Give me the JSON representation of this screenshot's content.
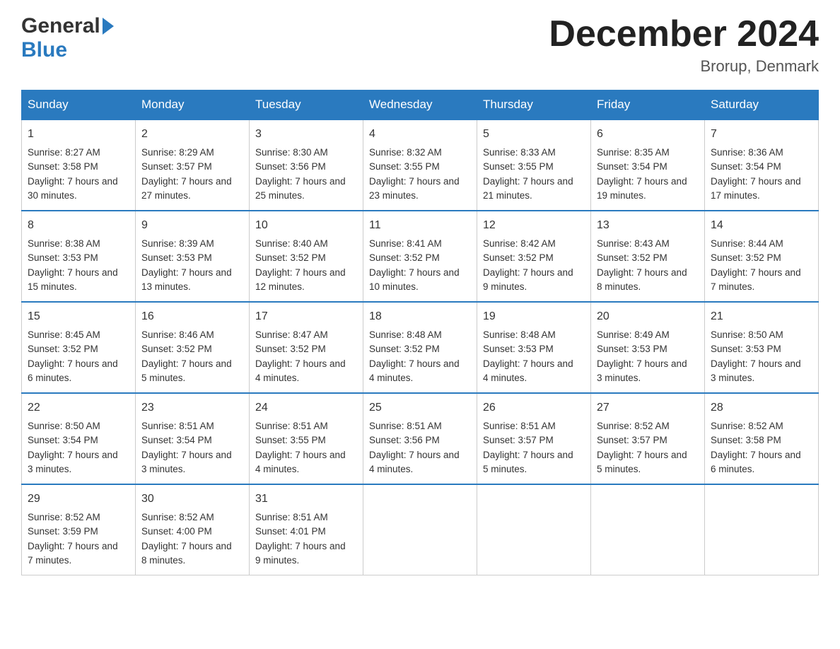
{
  "header": {
    "logo_general": "General",
    "logo_blue": "Blue",
    "month_title": "December 2024",
    "location": "Brorup, Denmark"
  },
  "days_of_week": [
    "Sunday",
    "Monday",
    "Tuesday",
    "Wednesday",
    "Thursday",
    "Friday",
    "Saturday"
  ],
  "weeks": [
    [
      {
        "day": "1",
        "sunrise": "Sunrise: 8:27 AM",
        "sunset": "Sunset: 3:58 PM",
        "daylight": "Daylight: 7 hours and 30 minutes."
      },
      {
        "day": "2",
        "sunrise": "Sunrise: 8:29 AM",
        "sunset": "Sunset: 3:57 PM",
        "daylight": "Daylight: 7 hours and 27 minutes."
      },
      {
        "day": "3",
        "sunrise": "Sunrise: 8:30 AM",
        "sunset": "Sunset: 3:56 PM",
        "daylight": "Daylight: 7 hours and 25 minutes."
      },
      {
        "day": "4",
        "sunrise": "Sunrise: 8:32 AM",
        "sunset": "Sunset: 3:55 PM",
        "daylight": "Daylight: 7 hours and 23 minutes."
      },
      {
        "day": "5",
        "sunrise": "Sunrise: 8:33 AM",
        "sunset": "Sunset: 3:55 PM",
        "daylight": "Daylight: 7 hours and 21 minutes."
      },
      {
        "day": "6",
        "sunrise": "Sunrise: 8:35 AM",
        "sunset": "Sunset: 3:54 PM",
        "daylight": "Daylight: 7 hours and 19 minutes."
      },
      {
        "day": "7",
        "sunrise": "Sunrise: 8:36 AM",
        "sunset": "Sunset: 3:54 PM",
        "daylight": "Daylight: 7 hours and 17 minutes."
      }
    ],
    [
      {
        "day": "8",
        "sunrise": "Sunrise: 8:38 AM",
        "sunset": "Sunset: 3:53 PM",
        "daylight": "Daylight: 7 hours and 15 minutes."
      },
      {
        "day": "9",
        "sunrise": "Sunrise: 8:39 AM",
        "sunset": "Sunset: 3:53 PM",
        "daylight": "Daylight: 7 hours and 13 minutes."
      },
      {
        "day": "10",
        "sunrise": "Sunrise: 8:40 AM",
        "sunset": "Sunset: 3:52 PM",
        "daylight": "Daylight: 7 hours and 12 minutes."
      },
      {
        "day": "11",
        "sunrise": "Sunrise: 8:41 AM",
        "sunset": "Sunset: 3:52 PM",
        "daylight": "Daylight: 7 hours and 10 minutes."
      },
      {
        "day": "12",
        "sunrise": "Sunrise: 8:42 AM",
        "sunset": "Sunset: 3:52 PM",
        "daylight": "Daylight: 7 hours and 9 minutes."
      },
      {
        "day": "13",
        "sunrise": "Sunrise: 8:43 AM",
        "sunset": "Sunset: 3:52 PM",
        "daylight": "Daylight: 7 hours and 8 minutes."
      },
      {
        "day": "14",
        "sunrise": "Sunrise: 8:44 AM",
        "sunset": "Sunset: 3:52 PM",
        "daylight": "Daylight: 7 hours and 7 minutes."
      }
    ],
    [
      {
        "day": "15",
        "sunrise": "Sunrise: 8:45 AM",
        "sunset": "Sunset: 3:52 PM",
        "daylight": "Daylight: 7 hours and 6 minutes."
      },
      {
        "day": "16",
        "sunrise": "Sunrise: 8:46 AM",
        "sunset": "Sunset: 3:52 PM",
        "daylight": "Daylight: 7 hours and 5 minutes."
      },
      {
        "day": "17",
        "sunrise": "Sunrise: 8:47 AM",
        "sunset": "Sunset: 3:52 PM",
        "daylight": "Daylight: 7 hours and 4 minutes."
      },
      {
        "day": "18",
        "sunrise": "Sunrise: 8:48 AM",
        "sunset": "Sunset: 3:52 PM",
        "daylight": "Daylight: 7 hours and 4 minutes."
      },
      {
        "day": "19",
        "sunrise": "Sunrise: 8:48 AM",
        "sunset": "Sunset: 3:53 PM",
        "daylight": "Daylight: 7 hours and 4 minutes."
      },
      {
        "day": "20",
        "sunrise": "Sunrise: 8:49 AM",
        "sunset": "Sunset: 3:53 PM",
        "daylight": "Daylight: 7 hours and 3 minutes."
      },
      {
        "day": "21",
        "sunrise": "Sunrise: 8:50 AM",
        "sunset": "Sunset: 3:53 PM",
        "daylight": "Daylight: 7 hours and 3 minutes."
      }
    ],
    [
      {
        "day": "22",
        "sunrise": "Sunrise: 8:50 AM",
        "sunset": "Sunset: 3:54 PM",
        "daylight": "Daylight: 7 hours and 3 minutes."
      },
      {
        "day": "23",
        "sunrise": "Sunrise: 8:51 AM",
        "sunset": "Sunset: 3:54 PM",
        "daylight": "Daylight: 7 hours and 3 minutes."
      },
      {
        "day": "24",
        "sunrise": "Sunrise: 8:51 AM",
        "sunset": "Sunset: 3:55 PM",
        "daylight": "Daylight: 7 hours and 4 minutes."
      },
      {
        "day": "25",
        "sunrise": "Sunrise: 8:51 AM",
        "sunset": "Sunset: 3:56 PM",
        "daylight": "Daylight: 7 hours and 4 minutes."
      },
      {
        "day": "26",
        "sunrise": "Sunrise: 8:51 AM",
        "sunset": "Sunset: 3:57 PM",
        "daylight": "Daylight: 7 hours and 5 minutes."
      },
      {
        "day": "27",
        "sunrise": "Sunrise: 8:52 AM",
        "sunset": "Sunset: 3:57 PM",
        "daylight": "Daylight: 7 hours and 5 minutes."
      },
      {
        "day": "28",
        "sunrise": "Sunrise: 8:52 AM",
        "sunset": "Sunset: 3:58 PM",
        "daylight": "Daylight: 7 hours and 6 minutes."
      }
    ],
    [
      {
        "day": "29",
        "sunrise": "Sunrise: 8:52 AM",
        "sunset": "Sunset: 3:59 PM",
        "daylight": "Daylight: 7 hours and 7 minutes."
      },
      {
        "day": "30",
        "sunrise": "Sunrise: 8:52 AM",
        "sunset": "Sunset: 4:00 PM",
        "daylight": "Daylight: 7 hours and 8 minutes."
      },
      {
        "day": "31",
        "sunrise": "Sunrise: 8:51 AM",
        "sunset": "Sunset: 4:01 PM",
        "daylight": "Daylight: 7 hours and 9 minutes."
      },
      null,
      null,
      null,
      null
    ]
  ]
}
